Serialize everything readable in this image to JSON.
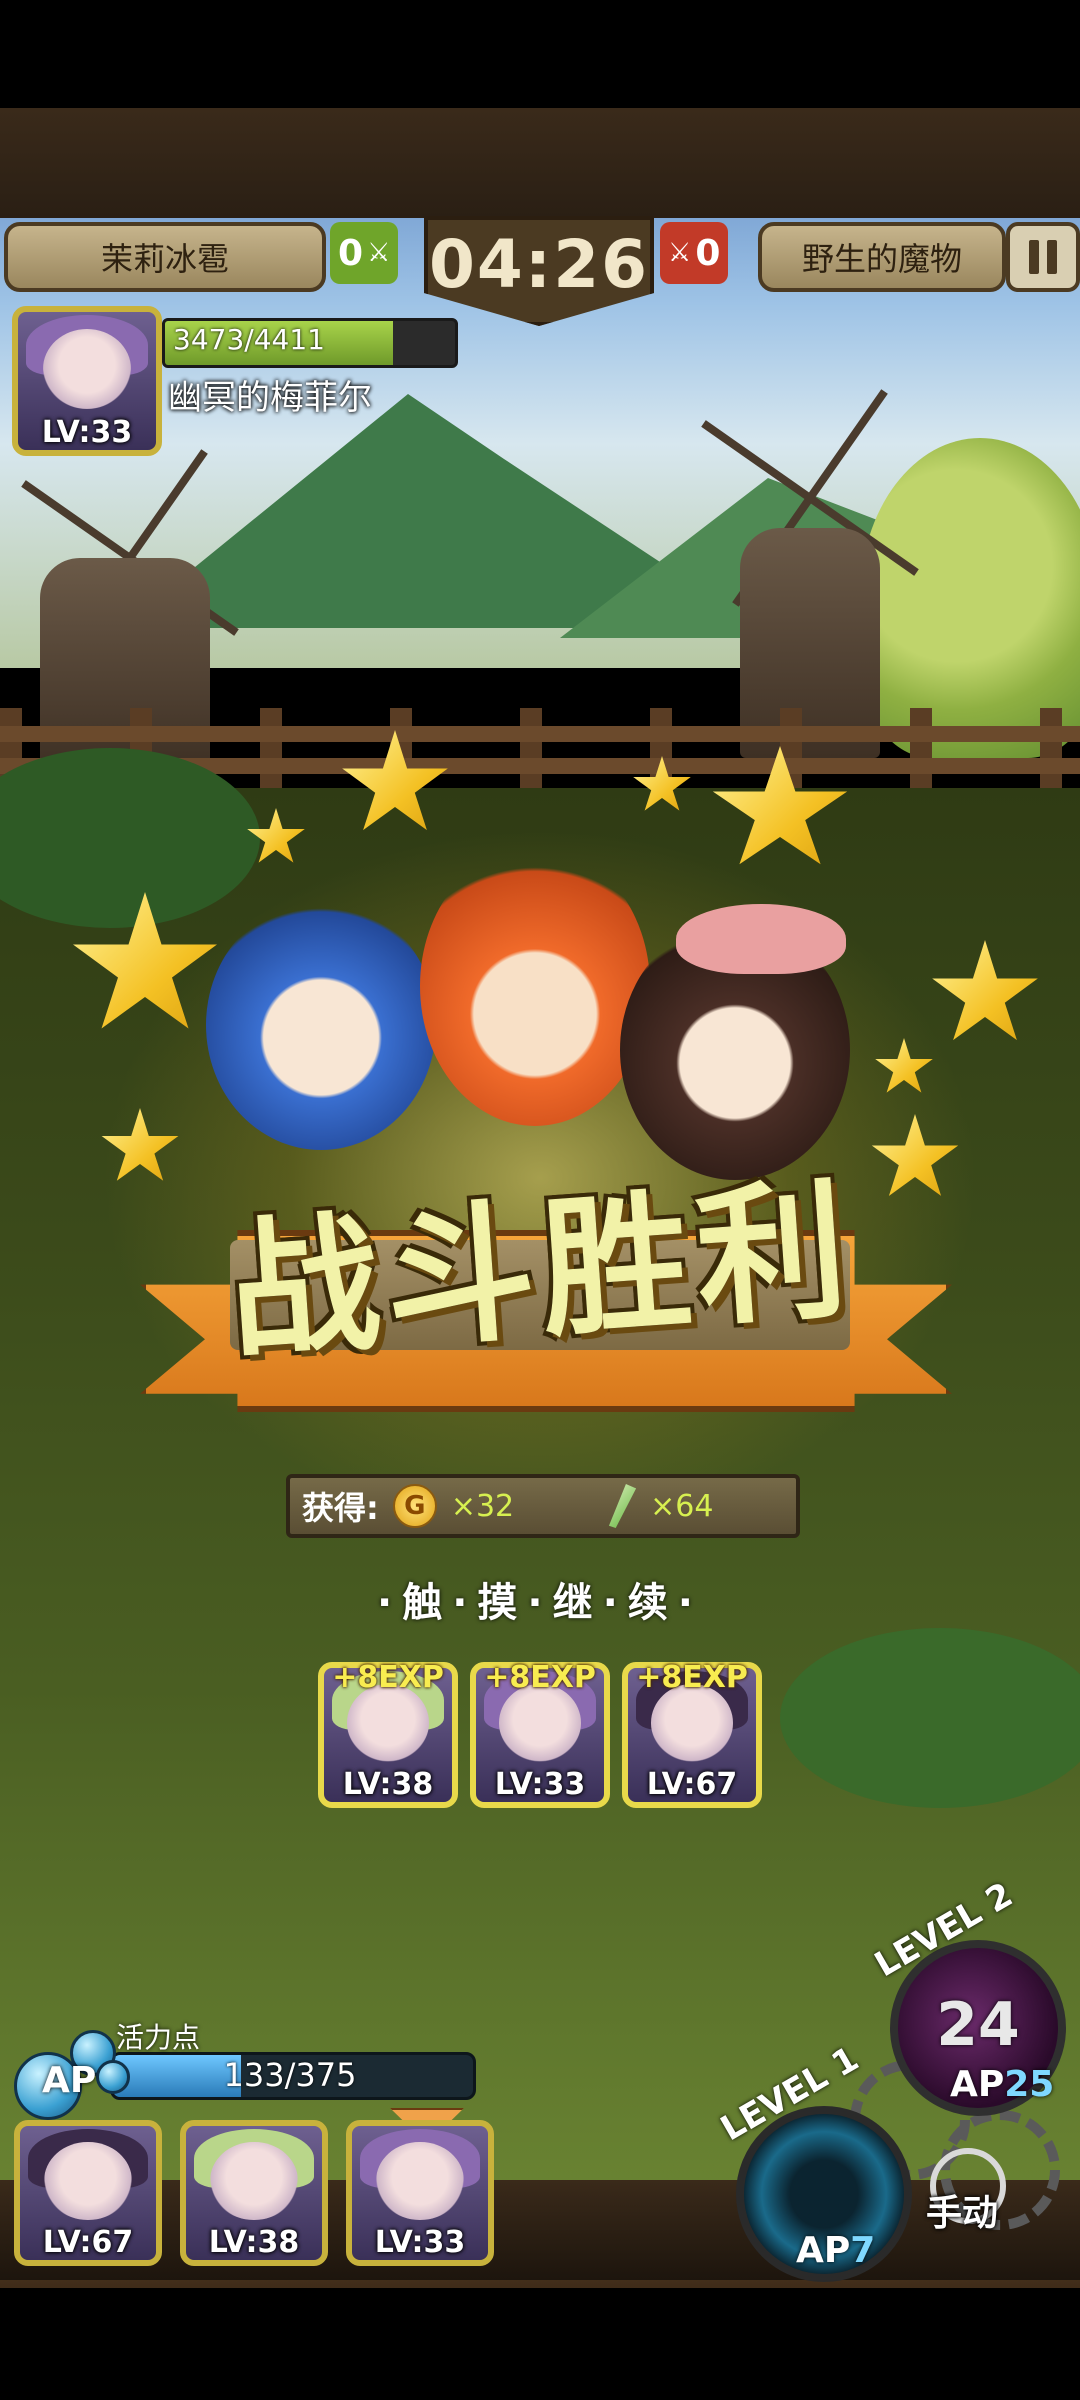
{
  "hud": {
    "player_name": "茉莉冰雹",
    "player_score": "0",
    "timer": "04:26",
    "enemy_score": "0",
    "enemy_side_name": "野生的魔物"
  },
  "enemy": {
    "name": "幽冥的梅菲尔",
    "level": "LV:33",
    "hp_text": "3473/4411",
    "hp_fraction": 0.787
  },
  "victory": {
    "title": "战斗胜利",
    "reward_label": "获得:",
    "coin_glyph": "G",
    "coins": "×32",
    "feathers": "×64",
    "continue_prompt": "·触·摸·继·续·"
  },
  "exp_cards": [
    {
      "exp": "+8EXP",
      "level": "LV:38"
    },
    {
      "exp": "+8EXP",
      "level": "LV:33"
    },
    {
      "exp": "+8EXP",
      "level": "LV:67"
    }
  ],
  "vitality": {
    "label": "活力点",
    "ap_label": "AP",
    "value_text": "133/375",
    "fraction": 0.355
  },
  "team": [
    {
      "level": "LV:67"
    },
    {
      "level": "LV:38"
    },
    {
      "level": "LV:33"
    }
  ],
  "skills": {
    "level2_label": "LEVEL 2",
    "level2_count": "24",
    "level2_ap_prefix": "AP",
    "level2_ap": "25",
    "level1_label": "LEVEL 1",
    "level1_ap_prefix": "AP",
    "level1_ap": "7",
    "manual_label": "手动"
  },
  "colors": {
    "player_score_bg": "#6fa52a",
    "enemy_score_bg": "#c23a28",
    "gold": "#f4c124",
    "ribbon": "#f0a24a"
  },
  "icons": [
    "pause-icon",
    "coin-icon",
    "feather-icon",
    "gear-icon",
    "star-icon"
  ]
}
